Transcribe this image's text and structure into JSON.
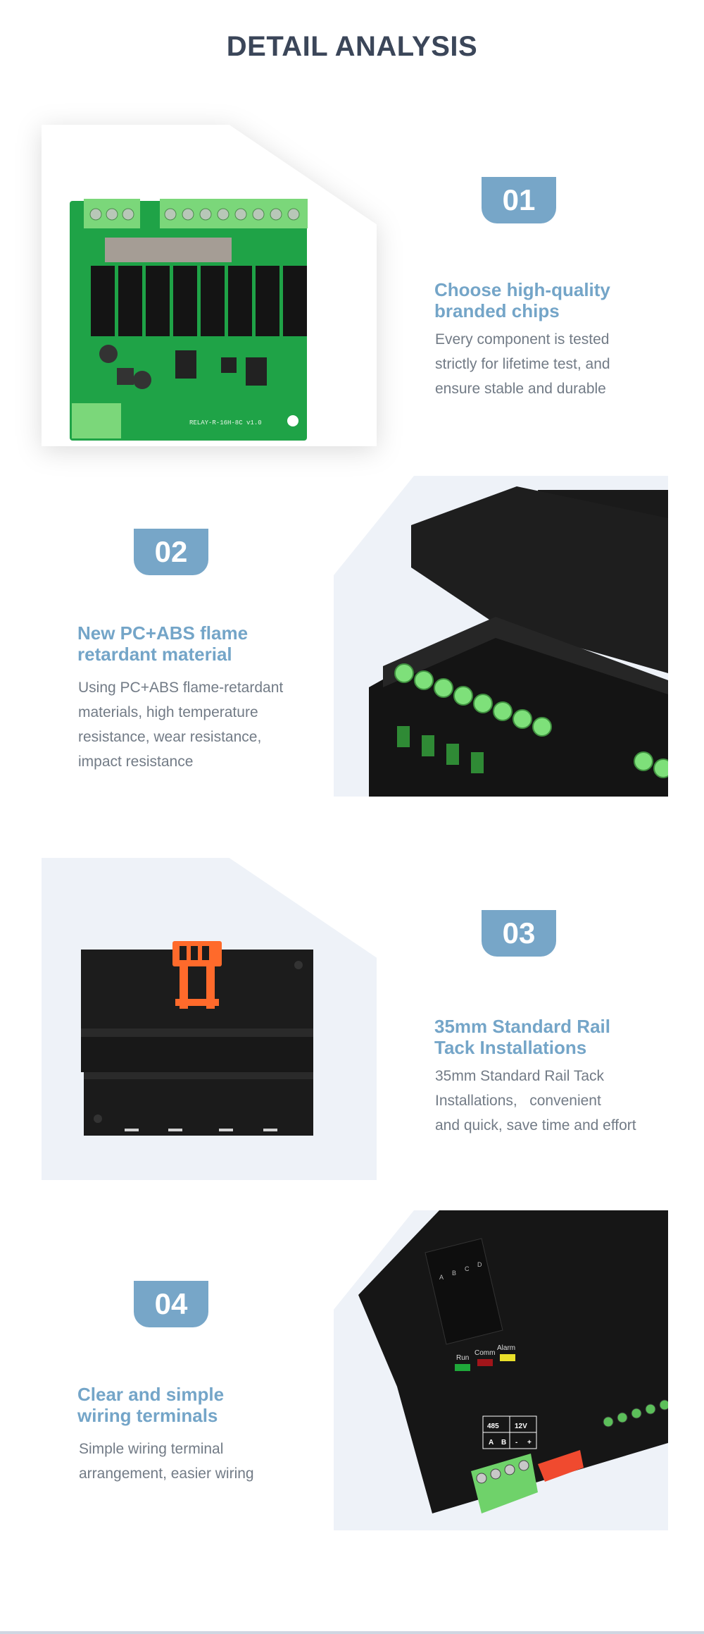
{
  "title": "DETAIL ANALYSIS",
  "colors": {
    "accent": "#77a6c8",
    "heading": "#74a5c8",
    "title": "#3b4659",
    "body": "#727b86",
    "panel": "#eef2f8"
  },
  "sections": [
    {
      "number": "01",
      "heading_lines": [
        "Choose high-quality",
        "branded chips"
      ],
      "body_lines": [
        "Every component is tested",
        "strictly for lifetime test, and",
        "ensure stable and durable"
      ],
      "image": "pcb-board-image",
      "pcb_label": "RELAY-R-16H-8C  v1.0"
    },
    {
      "number": "02",
      "heading_lines": [
        "New PC+ABS flame",
        "retardant material"
      ],
      "body_lines": [
        "Using PC+ABS flame-retardant",
        "materials, high temperature",
        "resistance, wear resistance,",
        "impact resistance"
      ],
      "image": "enclosure-closeup-image"
    },
    {
      "number": "03",
      "heading_lines": [
        "35mm Standard Rail",
        "Tack Installations"
      ],
      "body_lines": [
        "35mm Standard Rail Tack",
        "Installations,   convenient",
        "and quick, save time and effort"
      ],
      "image": "din-rail-clip-image"
    },
    {
      "number": "04",
      "heading_lines": [
        "Clear and simple",
        "wiring terminals"
      ],
      "body_lines": [
        "Simple wiring terminal",
        "arrangement, easier wiring"
      ],
      "image": "terminal-panel-image",
      "device_labels": {
        "leds": [
          "A",
          "B",
          "C",
          "D"
        ],
        "status": [
          "Run",
          "Comm",
          "Alarm"
        ],
        "terminal_header": [
          "485",
          "12V"
        ],
        "terminal_pins": [
          "A",
          "B",
          "-",
          "+"
        ]
      }
    }
  ]
}
